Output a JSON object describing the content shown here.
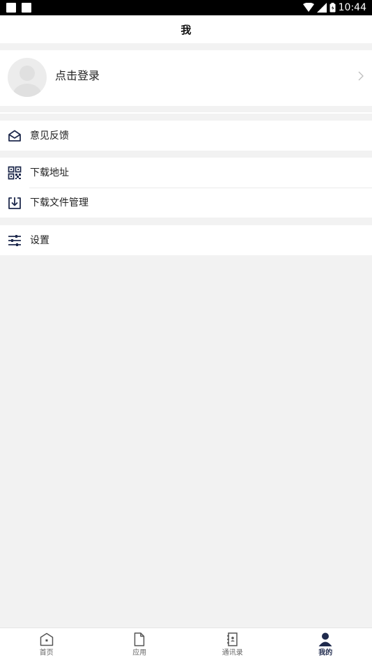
{
  "status_bar": {
    "time": "10:44"
  },
  "header": {
    "title": "我"
  },
  "profile": {
    "login_label": "点击登录"
  },
  "menu": {
    "feedback": "意见反馈",
    "download_address": "下载地址",
    "download_files": "下载文件管理",
    "settings": "设置"
  },
  "tabs": [
    {
      "label": "首页",
      "icon": "home-icon"
    },
    {
      "label": "应用",
      "icon": "document-icon"
    },
    {
      "label": "通讯录",
      "icon": "contacts-icon"
    },
    {
      "label": "我的",
      "icon": "person-icon",
      "active": true
    }
  ],
  "colors": {
    "accent": "#1f2a4d",
    "background": "#f2f2f2"
  }
}
